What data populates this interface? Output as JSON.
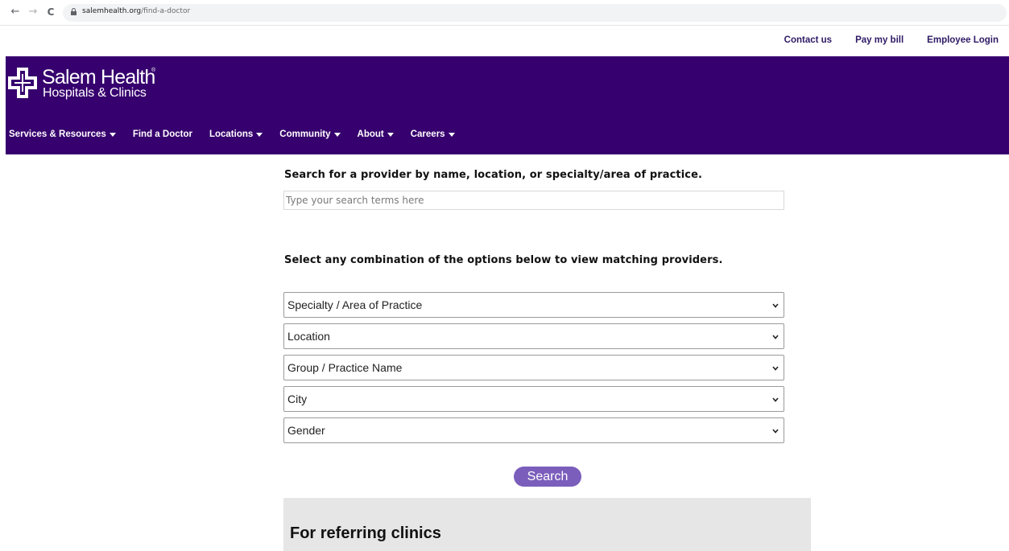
{
  "browser": {
    "url_domain": "salemhealth.org",
    "url_path": "/find-a-doctor",
    "back_glyph": "←",
    "forward_glyph": "→",
    "reload_glyph": "C"
  },
  "utility_links": [
    "Contact us",
    "Pay my bill",
    "Employee Login"
  ],
  "logo": {
    "title": "Salem Health",
    "registered": "®",
    "subtitle": "Hospitals & Clinics"
  },
  "main_nav": [
    {
      "label": "Services & Resources",
      "has_dropdown": true
    },
    {
      "label": "Find a Doctor",
      "has_dropdown": false
    },
    {
      "label": "Locations",
      "has_dropdown": true
    },
    {
      "label": "Community",
      "has_dropdown": true
    },
    {
      "label": "About",
      "has_dropdown": true
    },
    {
      "label": "Careers",
      "has_dropdown": true
    }
  ],
  "search": {
    "heading": "Search for a provider by name, location, or specialty/area of practice.",
    "placeholder": "Type your search terms here",
    "value": ""
  },
  "filters": {
    "heading": "Select any combination of the options below to view matching providers.",
    "selects": [
      "Specialty / Area of Practice",
      "Location",
      "Group / Practice Name",
      "City",
      "Gender"
    ]
  },
  "search_button": "Search",
  "referring": {
    "title": "For referring clinics"
  },
  "colors": {
    "header_bg": "#36006e",
    "utility_link": "#2e1a66",
    "button_bg": "#7b5ebb",
    "panel_bg": "#e6e6e6"
  },
  "icons": {
    "lock": "lock-icon",
    "logo": "salem-health-cross-logo",
    "dropdown": "caret-down-icon",
    "select": "chevron-down-icon"
  }
}
